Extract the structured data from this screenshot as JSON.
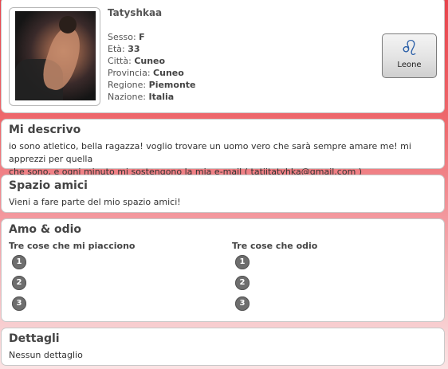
{
  "profile": {
    "username": "Tatyshkaa",
    "fields": [
      {
        "label": "Sesso:",
        "value": "F"
      },
      {
        "label": "Età:",
        "value": "33"
      },
      {
        "label": "Città:",
        "value": "Cuneo"
      },
      {
        "label": "Provincia:",
        "value": "Cuneo"
      },
      {
        "label": "Regione:",
        "value": "Piemonte"
      },
      {
        "label": "Nazione:",
        "value": "Italia"
      }
    ],
    "zodiac": {
      "symbol": "♌",
      "label": "Leone",
      "icon": "leo-zodiac-icon"
    }
  },
  "descrivo": {
    "title": "Mi descrivo",
    "text_line1": "io sono atletico, bella ragazza! voglio trovare un uomo vero che sarà sempre amare me! mi apprezzi per quella",
    "text_line2": "che sono, e ogni minuto mi sostengono la mia e-mail ( tatiitatyhka@gmail.com )"
  },
  "amici": {
    "title": "Spazio amici",
    "text": "Vieni a fare parte del mio spazio amici!"
  },
  "amo_odio": {
    "title": "Amo & odio",
    "likes_header": "Tre cose che mi piacciono",
    "dislikes_header": "Tre cose che odio",
    "numbers": [
      "1",
      "2",
      "3"
    ]
  },
  "dettagli": {
    "title": "Dettagli",
    "text": "Nessun dettaglio"
  },
  "colors": {
    "background_top": "#e8434b",
    "zodiac_symbol": "#2a5fa8",
    "number_badge": "#6e6e6e"
  }
}
